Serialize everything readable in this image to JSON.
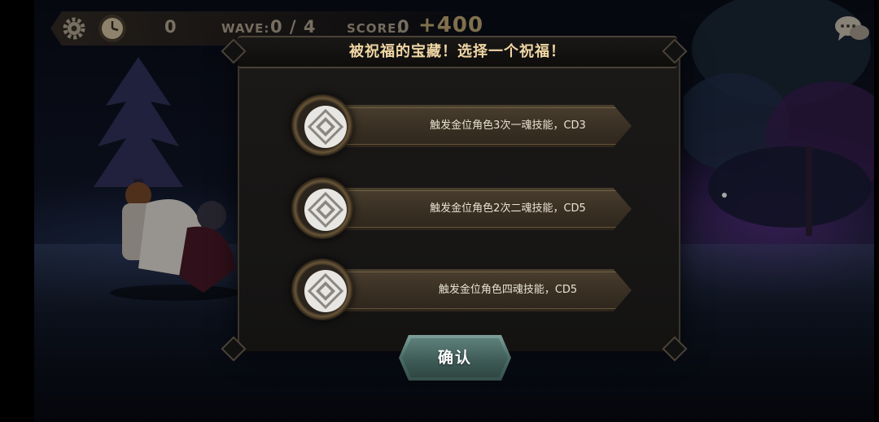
{
  "hud": {
    "coins": "0",
    "wave_label": "WAVE:",
    "wave_value": "0 / 4",
    "score_label": "SCORE:",
    "score_value": "0",
    "score_bonus": "+400"
  },
  "icons": {
    "settings": "gear-icon",
    "timer": "clock-icon",
    "chat": "chat-bubble-icon",
    "blessing": "diamond-rune-icon"
  },
  "dialog": {
    "title": "被祝福的宝藏！选择一个祝福！",
    "options": [
      {
        "label": "触发金位角色3次一魂技能，CD3"
      },
      {
        "label": "触发金位角色2次二魂技能，CD5"
      },
      {
        "label": "触发金位角色四魂技能，CD5"
      }
    ],
    "confirm_label": "确认"
  },
  "colors": {
    "title_text": "#f0d6a4",
    "confirm_button": "#4e6f6a",
    "ribbon": "#3a3024"
  }
}
